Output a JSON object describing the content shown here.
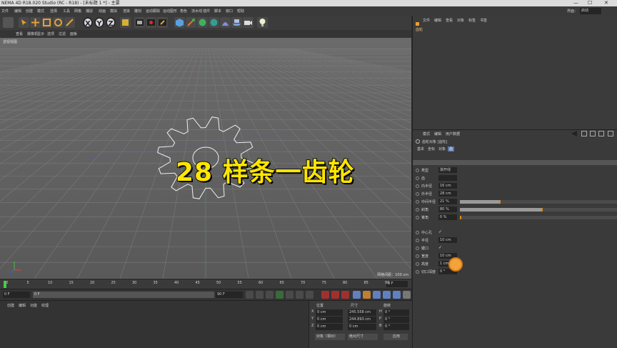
{
  "window": {
    "title": "NEMA 4D R18.020 Studio (RC - R18) - [未标题 1 *] - 主要"
  },
  "menubar": {
    "items": [
      "文件",
      "编辑",
      "创建",
      "模式",
      "选择",
      "工具",
      "网格",
      "捕捉",
      "动画",
      "模拟",
      "渲染",
      "雕刻",
      "运动跟踪",
      "运动图形",
      "角色",
      "流水线",
      "插件",
      "脚本",
      "窗口",
      "帮助"
    ],
    "right_label": "界面：",
    "right_value": "启动"
  },
  "toolbar": {
    "axis_x": "X",
    "axis_y": "Y",
    "axis_z": "Z"
  },
  "viewport": {
    "menu": [
      "查看",
      "摄像机",
      "显示",
      "选项",
      "过滤",
      "面板"
    ],
    "label": "透视视图",
    "grid_spacing": "网格间距：100 cm",
    "overlay_title": "28 样条一齿轮"
  },
  "timeline": {
    "ticks": [
      "0",
      "5",
      "10",
      "15",
      "20",
      "25",
      "30",
      "35",
      "40",
      "45",
      "50",
      "55",
      "60",
      "65",
      "70",
      "75",
      "80",
      "85",
      "90"
    ],
    "end_field": "0 F"
  },
  "transport": {
    "start_frame": "0 F",
    "current_frame": "0 F",
    "end_frame": "90 F",
    "max_frame": "90 F"
  },
  "bottom_left": {
    "tabs": [
      "创建",
      "编辑",
      "功能",
      "纹理"
    ]
  },
  "coordinates": {
    "headers": [
      "位置",
      "尺寸",
      "旋转"
    ],
    "rows": [
      {
        "axis": "X",
        "pos": "0 cm",
        "size": "245.558 cm",
        "rot_label": "H",
        "rot": "0 °"
      },
      {
        "axis": "Y",
        "pos": "0 cm",
        "size": "244.893 cm",
        "rot_label": "P",
        "rot": "0 °"
      },
      {
        "axis": "Z",
        "pos": "0 cm",
        "size": "0 cm",
        "rot_label": "B",
        "rot": "0 °"
      }
    ],
    "mode_select": "对象（相对）",
    "size_select": "绝对尺寸",
    "apply_button": "应用"
  },
  "right_top": {
    "menu": [
      "文件",
      "编辑",
      "查看",
      "对象",
      "标签",
      "书签"
    ],
    "object_name": "齿轮"
  },
  "attributes": {
    "menu": [
      "模式",
      "编辑",
      "用户数据"
    ],
    "object_title": "齿轮对象 [齿轮]",
    "tabs": [
      "基本",
      "坐标",
      "对象",
      "齿"
    ],
    "rows": [
      {
        "label": "类型",
        "value": "渐开线",
        "fill": null
      },
      {
        "label": "齿",
        "value": "",
        "fill": null
      },
      {
        "label": "内半径",
        "value": "16 cm",
        "fill": null
      },
      {
        "label": "外半径",
        "value": "28 cm",
        "fill": null
      },
      {
        "label": "中间半径",
        "value": "21 %",
        "fill": 0.25
      },
      {
        "label": "斜角",
        "value": "80 %",
        "fill": 0.52
      },
      {
        "label": "锥角",
        "value": "0 %",
        "fill": 0.0
      },
      {
        "label": "中心孔",
        "value": "✓",
        "fill": null
      },
      {
        "label": "半径",
        "value": "10 cm",
        "fill": null
      },
      {
        "label": "键口",
        "value": "✓",
        "fill": null
      },
      {
        "label": "宽度",
        "value": "10 cm",
        "fill": null
      },
      {
        "label": "高度",
        "value": "1 cm",
        "fill": null
      },
      {
        "label": "切口深度",
        "value": "0 °",
        "fill": null
      }
    ]
  }
}
